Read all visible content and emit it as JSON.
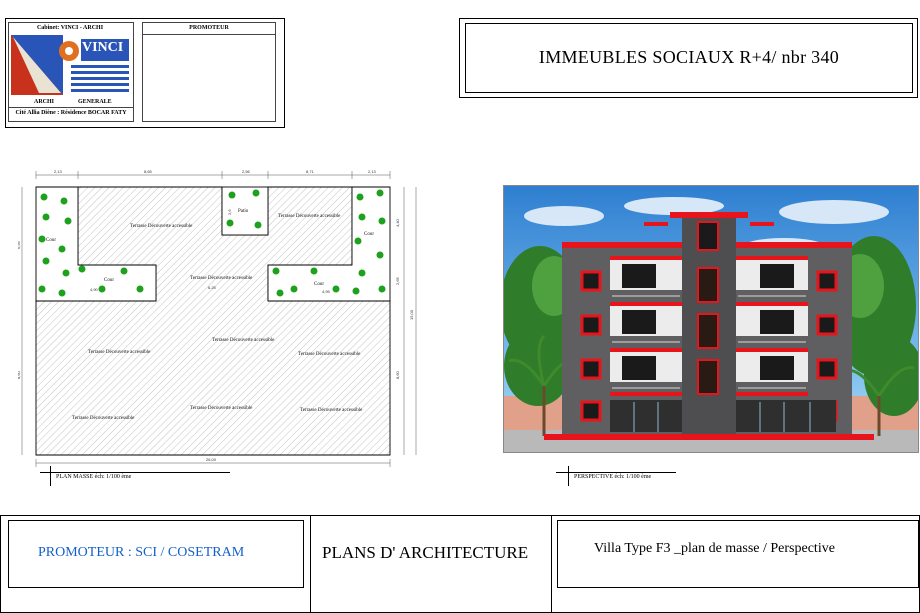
{
  "cartouche": {
    "cabinet_label": "Cabinet:  VINCI - ARCHI",
    "logo_text": "VINCI",
    "archi_label": "ARCHI",
    "generale_label": "GENERALE",
    "address": "Cité Allia Diène :  Résidence  BOCAR  FATY",
    "promoteur_header": "PROMOTEUR"
  },
  "title": "IMMEUBLES   SOCIAUX  R+4/ nbr 340",
  "plan": {
    "caption": "PLAN MASSE   éch: 1/100 ème",
    "terrace_label": "Terrasse Découverte accessible",
    "court_label": "Cour",
    "patio_label": "Patio",
    "dimensions_top": [
      "2,13",
      "8,65",
      "2,56",
      "8,71",
      "2,13"
    ],
    "dimension_bottom": "26,00",
    "dimensions_right": [
      "4,40",
      "2,65",
      "15,00",
      "8,60"
    ],
    "dimensions_left": [
      "6,95",
      "8,60"
    ],
    "inner_dims": [
      "4,90",
      "6,25",
      "4,95",
      "2,6"
    ]
  },
  "perspective": {
    "caption": "PERSPECTIVE  éch: 1/100 ème"
  },
  "footer": {
    "promoteur": "PROMOTEUR : SCI / COSETRAM",
    "plans": "PLANS D' ARCHITECTURE",
    "villa": "Villa  Type F3  _plan de masse / Perspective"
  },
  "colors": {
    "footer_blue": "#1560c8",
    "accent_red": "#e8141b",
    "wall_grey": "#5f5f62",
    "sky_blue": "#3f95dc"
  }
}
